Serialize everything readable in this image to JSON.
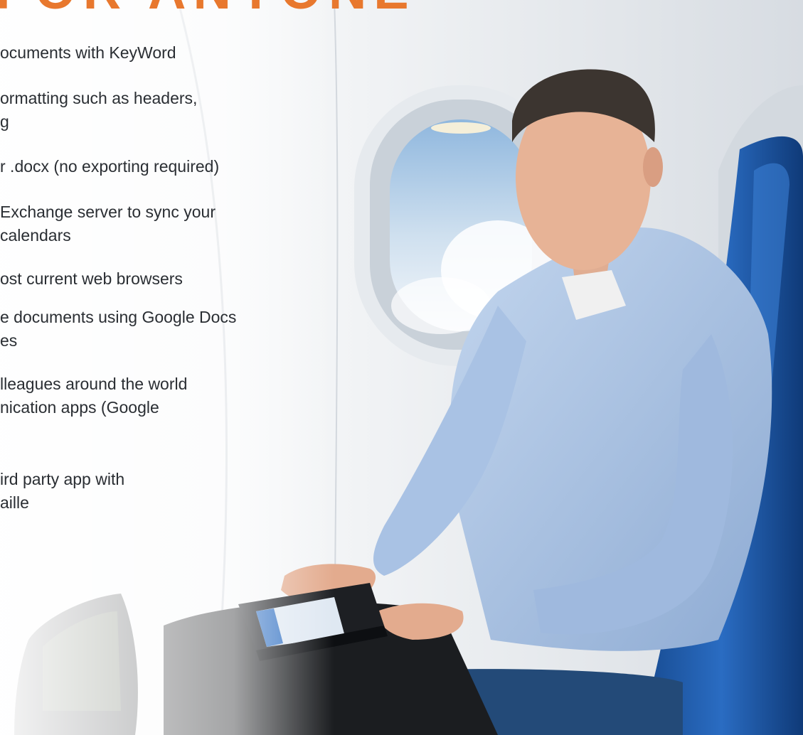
{
  "heading": "FOR ANYONE",
  "features": [
    {
      "lines": [
        "ocuments with KeyWord"
      ]
    },
    {
      "lines": [
        "ormatting such as headers,",
        "g"
      ]
    },
    {
      "lines": [
        "r .docx (no exporting required)"
      ]
    },
    {
      "lines": [
        "Exchange server to sync your",
        "calendars"
      ]
    },
    {
      "lines": [
        "ost current web browsers"
      ]
    },
    {
      "lines": [
        "e documents using Google Docs",
        "es"
      ]
    },
    {
      "lines": [
        "lleagues around the world",
        "nication apps (Google"
      ]
    },
    {
      "lines": [
        "ird party app with",
        "aille"
      ]
    }
  ],
  "colors": {
    "accent": "#e8782e",
    "text": "#2a2e33",
    "sky": "#a9c9e6",
    "shirt": "#aec6e6",
    "seat": "#1e5aa8"
  },
  "icons": [
    "tablet-device",
    "airplane-window",
    "airplane-seat"
  ]
}
